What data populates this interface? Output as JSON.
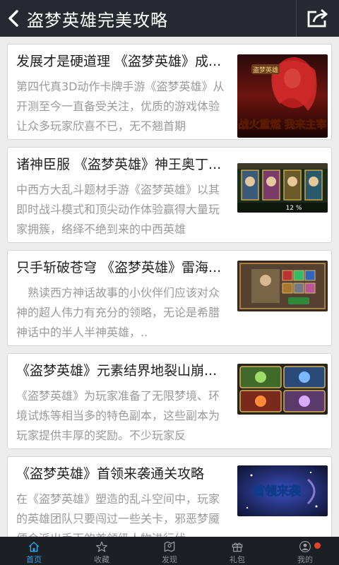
{
  "header": {
    "title": "盗梦英雄完美攻略",
    "back_icon": "back-arrow-icon",
    "share_icon": "share-icon"
  },
  "articles": [
    {
      "title": "发展才是硬道理 《盗梦英雄》成...",
      "desc": "第四代真3D动作卡牌手游《盗梦英雄》从开测至今一直备受关注，优质的游戏体验让众多玩家欣喜不已，无不翘首期",
      "thumb_text": "战火重燃 我来主宰",
      "thumb_logo": "盗梦英雄"
    },
    {
      "title": "诸神臣服 《盗梦英雄》神王奥丁...",
      "desc": "中西方大乱斗题材手游《盗梦英雄》以其即时战斗模式和顶尖动作体验赢得大量玩家拥簇，络绎不绝到来的中西英雄",
      "thumb_text": "12 %",
      "thumb_logo": ""
    },
    {
      "title": "只手斩破苍穹 《盗梦英雄》雷海...",
      "desc": "　熟读西方神话故事的小伙伴们应该对众神的超人伟力有充分的领略，无论是希腊神话中的半人半神英雄，..",
      "thumb_text": "",
      "thumb_logo": ""
    },
    {
      "title": "《盗梦英雄》元素结界地裂山崩...",
      "desc": "《盗梦英雄》为玩家准备了无限梦境、环境试炼等相当多的特色副本，这些副本为玩家提供丰厚的奖励。不少玩家反",
      "thumb_text": "",
      "thumb_logo": ""
    },
    {
      "title": "《盗梦英雄》首领来袭通关攻略",
      "desc": "在《盗梦英雄》塑造的乱斗空间中，玩家的英雄团队只要闯过一些关卡，邪恶梦魇便会派出手下的首领级人物进行伏",
      "thumb_text": "首领来袭",
      "thumb_logo": ""
    }
  ],
  "tabbar": {
    "tabs": [
      {
        "icon": "home-icon",
        "label": "首页"
      },
      {
        "icon": "star-icon",
        "label": "收藏"
      },
      {
        "icon": "map-icon",
        "label": "发现"
      },
      {
        "icon": "gift-icon",
        "label": "礼包"
      },
      {
        "icon": "user-icon",
        "label": "我的"
      }
    ],
    "active_color": "#2aa3e6"
  }
}
